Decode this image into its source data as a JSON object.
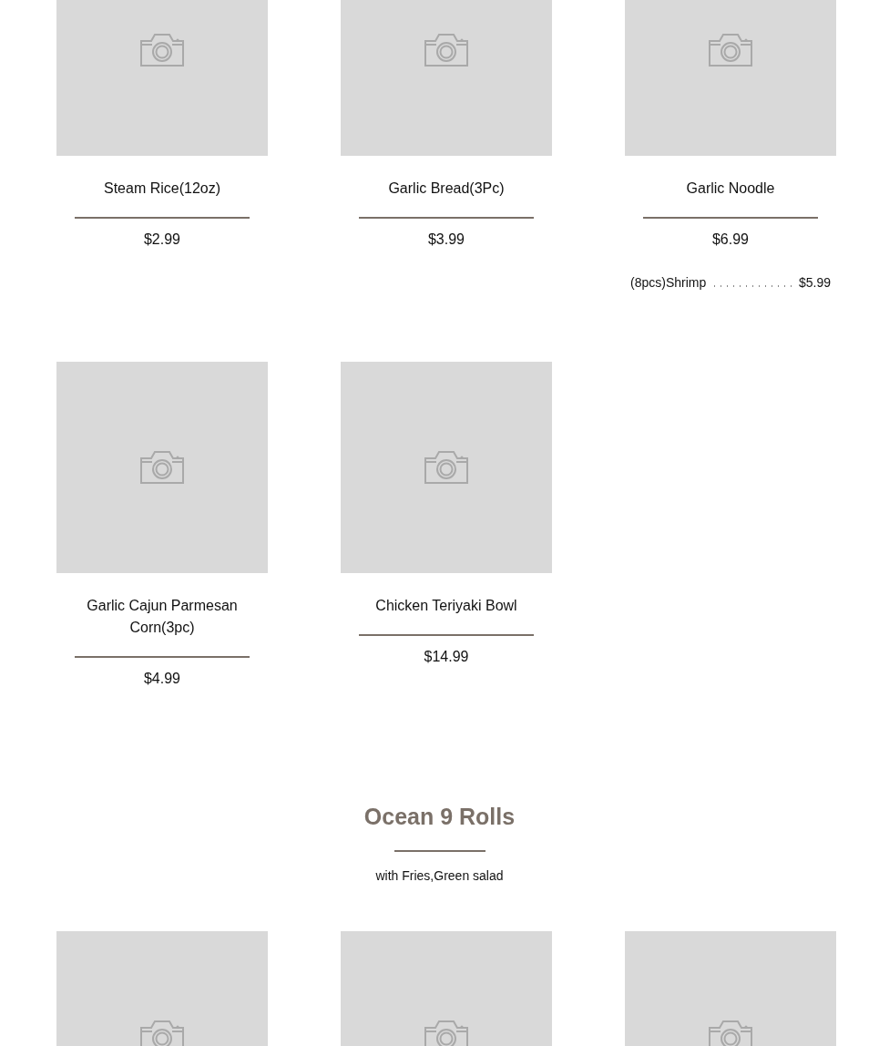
{
  "sections": [
    {
      "items": [
        {
          "kind": "placeholder",
          "name": "Steam Rice(12oz)",
          "price": "$2.99"
        },
        {
          "kind": "placeholder",
          "name": "Garlic Bread(3Pc)",
          "price": "$3.99"
        },
        {
          "kind": "placeholder",
          "name": "Garlic Noodle",
          "price": "$6.99",
          "extras": [
            {
              "name": "(8pcs)Shrimp",
              "price": "$5.99"
            }
          ]
        },
        {
          "kind": "placeholder",
          "name": "Garlic Cajun Parmesan Corn(3pc)",
          "price": "$4.99"
        },
        {
          "kind": "placeholder",
          "name": "Chicken Teriyaki Bowl",
          "price": "$14.99"
        }
      ]
    },
    {
      "title": "Ocean 9 Rolls",
      "subtitle": "with Fries,Green salad",
      "items": [
        {
          "kind": "placeholder"
        },
        {
          "kind": "placeholder"
        },
        {
          "kind": "placeholder"
        }
      ]
    }
  ]
}
